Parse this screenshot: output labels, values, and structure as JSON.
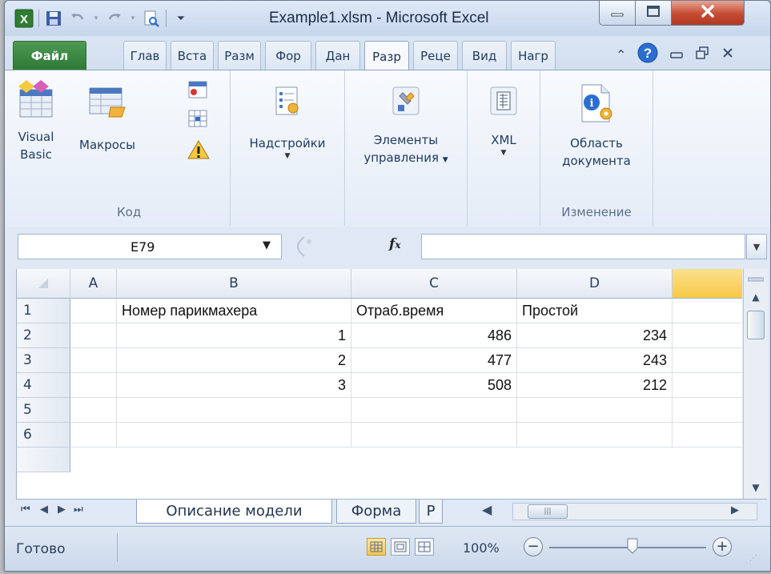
{
  "window": {
    "title": "Example1.xlsm  -  Microsoft Excel",
    "controls": {
      "minimize_icon": "minimize-icon",
      "maximize_icon": "maximize-icon",
      "close_icon": "close-icon"
    }
  },
  "quick_access": [
    "excel-app-icon",
    "save-icon",
    "undo-icon",
    "redo-icon",
    "print-preview-icon",
    "customize-qat-icon"
  ],
  "tabs": [
    {
      "label": "Файл"
    },
    {
      "label": "Глав"
    },
    {
      "label": "Вста"
    },
    {
      "label": "Разм"
    },
    {
      "label": "Фор"
    },
    {
      "label": "Дан"
    },
    {
      "label": "Разр"
    },
    {
      "label": "Реце"
    },
    {
      "label": "Вид"
    },
    {
      "label": "Нагр"
    }
  ],
  "ribbon": {
    "groups": [
      {
        "label": "Код",
        "buttons": [
          "Visual\nBasic",
          "Макросы"
        ]
      },
      {
        "label": "",
        "buttons": [
          "Надстройки"
        ]
      },
      {
        "label": "",
        "buttons": [
          "Элементы\nуправления"
        ]
      },
      {
        "label": "",
        "buttons": [
          "XML"
        ]
      },
      {
        "label": "Изменение",
        "buttons": [
          "Область\nдокумента"
        ]
      }
    ],
    "visual_basic_line1": "Visual",
    "visual_basic_line2": "Basic",
    "macros": "Макросы",
    "addins": "Надстройки",
    "controls_line1": "Элементы",
    "controls_line2": "управления",
    "xml": "XML",
    "docpanel_line1": "Область",
    "docpanel_line2": "документа",
    "group_code": "Код",
    "group_modify": "Изменение"
  },
  "formula_bar": {
    "name_box": "E79",
    "fx_label": "fx",
    "formula": ""
  },
  "sheet": {
    "columns": [
      "A",
      "B",
      "C",
      "D",
      ""
    ],
    "rows": [
      "1",
      "2",
      "3",
      "4",
      "5",
      "6"
    ],
    "cells": {
      "B1": "Номер парикмахера",
      "C1": "Отраб.время",
      "D1": "Простой",
      "B2": "1",
      "C2": "486",
      "D2": "234",
      "B3": "2",
      "C3": "477",
      "D3": "243",
      "B4": "3",
      "C4": "508",
      "D4": "212"
    }
  },
  "sheet_tabs": [
    "Описание модели",
    "Форма",
    "Р"
  ],
  "status": {
    "ready": "Готово",
    "zoom": "100%"
  },
  "colors": {
    "file_tab": "#2e7a35",
    "selected_column": "#f7c948",
    "close_button": "#c64a32"
  }
}
